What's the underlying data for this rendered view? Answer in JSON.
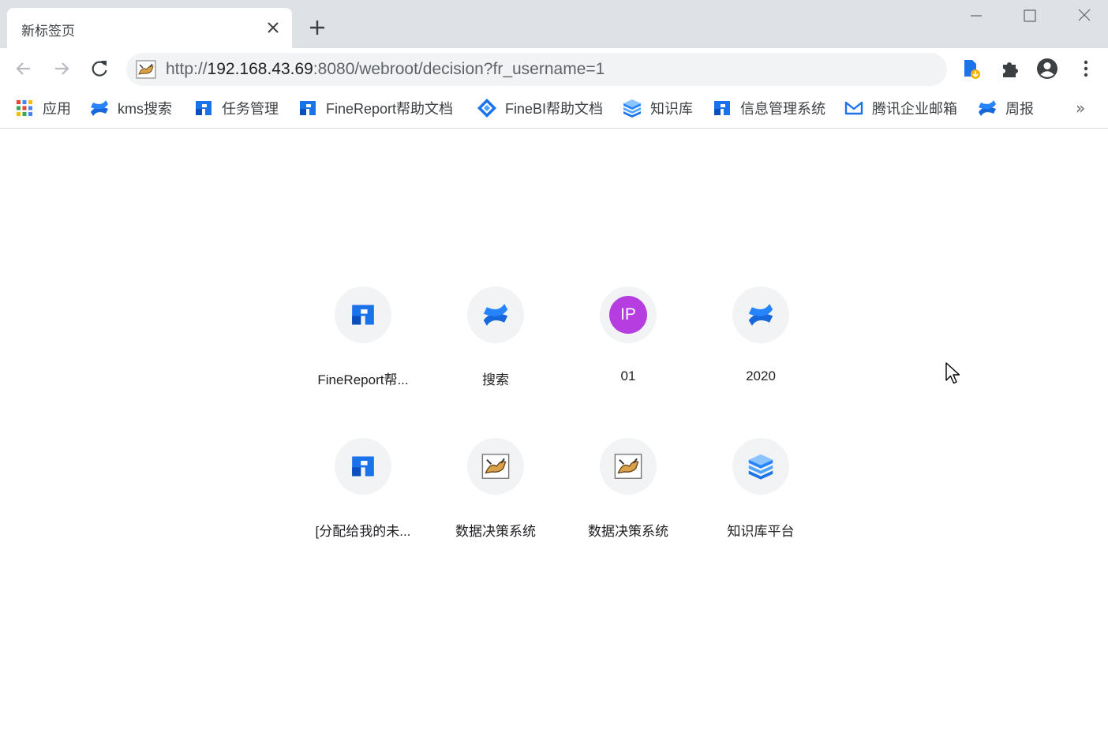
{
  "tab": {
    "title": "新标签页"
  },
  "address_bar": {
    "url_scheme": "http://",
    "url_host": "192.168.43.69",
    "url_path": ":8080/webroot/decision?fr_username=1"
  },
  "bookmarks": [
    {
      "label": "应用",
      "icon": "apps-grid-icon"
    },
    {
      "label": "kms搜索",
      "icon": "confluence-icon"
    },
    {
      "label": "任务管理",
      "icon": "finereport-icon"
    },
    {
      "label": "FineReport帮助文档",
      "icon": "finereport-icon"
    },
    {
      "label": "FineBI帮助文档",
      "icon": "finebi-icon"
    },
    {
      "label": "知识库",
      "icon": "knowledge-base-icon"
    },
    {
      "label": "信息管理系统",
      "icon": "finereport-icon"
    },
    {
      "label": "腾讯企业邮箱",
      "icon": "tencent-mail-icon"
    },
    {
      "label": "周报",
      "icon": "confluence-icon"
    }
  ],
  "bookmarks_more": "»",
  "shortcuts": [
    {
      "label": "FineReport帮...",
      "icon": "finereport-icon"
    },
    {
      "label": "搜索",
      "icon": "confluence-icon"
    },
    {
      "label": "01",
      "icon": "ip-badge",
      "badge_text": "IP",
      "badge_color": "#b63ee0"
    },
    {
      "label": "2020",
      "icon": "confluence-icon"
    },
    {
      "label": "[分配给我的未...",
      "icon": "finereport-icon"
    },
    {
      "label": "数据决策系统",
      "icon": "tomcat-icon"
    },
    {
      "label": "数据决策系统",
      "icon": "tomcat-icon"
    },
    {
      "label": "知识库平台",
      "icon": "knowledge-base-icon"
    }
  ],
  "colors": {
    "tabstrip": "#dee1e6",
    "omnibox": "#f1f3f4",
    "confluence_blue": "#1868db",
    "finereport_blue": "#1a73e8"
  }
}
